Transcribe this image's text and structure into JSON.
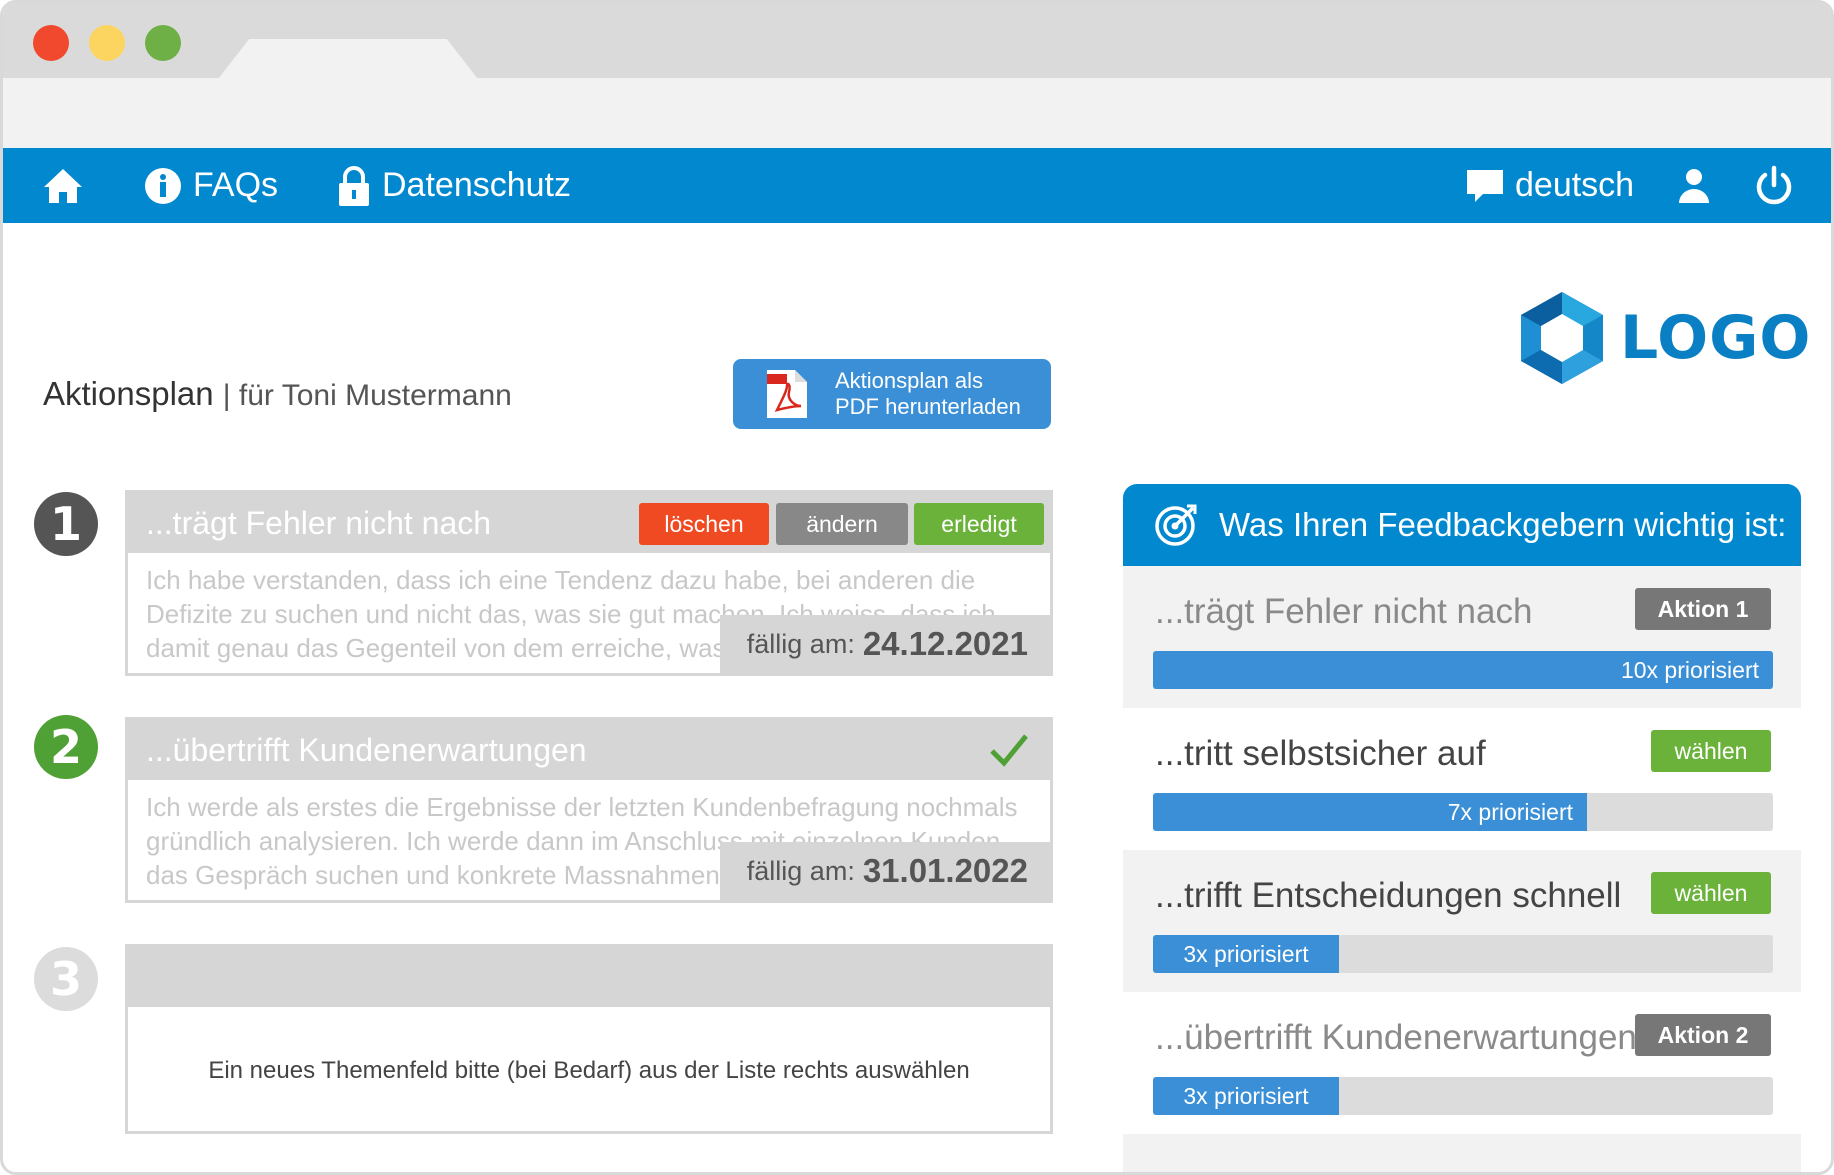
{
  "nav": {
    "faqs": "FAQs",
    "privacy": "Datenschutz",
    "language": "deutsch",
    "icons": [
      "home-icon",
      "info-icon",
      "lock-icon",
      "chat-bubble-icon",
      "user-icon",
      "power-icon"
    ]
  },
  "logo": {
    "text": "LOGO"
  },
  "header": {
    "title": "Aktionsplan",
    "subtitle": "| für Toni Mustermann",
    "pdf_button_line1": "Aktionsplan als",
    "pdf_button_line2": "PDF herunterladen"
  },
  "actions": [
    {
      "number": "1",
      "title": "...trägt Fehler nicht nach",
      "body": "Ich habe verstanden, dass ich eine Tendenz dazu habe, bei anderen die Defizite zu suchen und nicht das, was sie gut machen. Ich weiss, dass ich damit genau das Gegenteil von dem erreiche, was ich will.",
      "due_label": "fällig am:",
      "due_date": "24.12.2021",
      "buttons": {
        "delete": "löschen",
        "change": "ändern",
        "done": "erledigt"
      }
    },
    {
      "number": "2",
      "title": "...übertrifft Kundenerwartungen",
      "body": "Ich werde als erstes die Ergebnisse der letzten Kundenbefragung nochmals gründlich analysieren. Ich werde dann im Anschluss mit einzelnen Kunden das Gespräch suchen und konkrete Massnahmen ableiten.",
      "due_label": "fällig am:",
      "due_date": "31.01.2022",
      "completed": true
    },
    {
      "number": "3",
      "title": "",
      "hint": "Ein neues Themenfeld bitte (bei Bedarf) aus der Liste rechts auswählen"
    }
  ],
  "feedback": {
    "title": "Was Ihren Feedbackgebern wichtig ist:",
    "items": [
      {
        "label": "...trägt Fehler nicht nach",
        "tag": "Aktion 1",
        "bar_text": "10x priorisiert",
        "fraction": 1.0
      },
      {
        "label": "...tritt selbstsicher auf",
        "tag": "wählen",
        "bar_text": "7x priorisiert",
        "fraction": 0.7
      },
      {
        "label": "...trifft Entscheidungen schnell",
        "tag": "wählen",
        "bar_text": "3x priorisiert",
        "fraction": 0.3
      },
      {
        "label": "...übertrifft Kundenerwartungen",
        "tag": "Aktion 2",
        "bar_text": "3x priorisiert",
        "fraction": 0.3
      }
    ]
  },
  "colors": {
    "primary_blue": "#0288cf",
    "bar_blue": "#3a8fd6",
    "green": "#6ab23a",
    "red": "#f04a23",
    "grey": "#888888"
  }
}
